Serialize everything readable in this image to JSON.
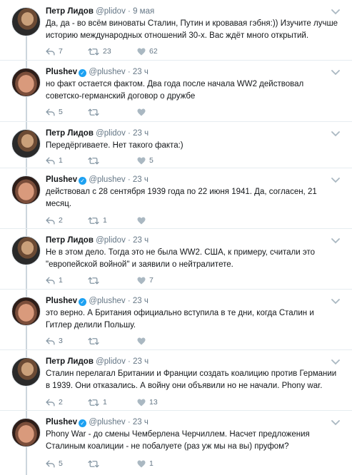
{
  "tweets": [
    {
      "author": "lidov",
      "name": "Петр Лидов",
      "handle": "@plidov",
      "time": "9 мая",
      "verified": false,
      "text": "Да, да - во всём виноваты Сталин, Путин и кровавая гэбня:)) Изучите лучше историю международных отношений 30-х. Вас ждёт много открытий.",
      "replies": "7",
      "retweets": "23",
      "likes": "62"
    },
    {
      "author": "plushev",
      "name": "Plushev",
      "handle": "@plushev",
      "time": "23 ч",
      "verified": true,
      "text": "но факт остается фактом. Два года после начала WW2 действовал советско-германский договор о дружбе",
      "replies": "5",
      "retweets": "",
      "likes": ""
    },
    {
      "author": "lidov",
      "name": "Петр Лидов",
      "handle": "@plidov",
      "time": "23 ч",
      "verified": false,
      "text": "Передёргиваете. Нет такого факта:)",
      "replies": "1",
      "retweets": "",
      "likes": "5"
    },
    {
      "author": "plushev",
      "name": "Plushev",
      "handle": "@plushev",
      "time": "23 ч",
      "verified": true,
      "text": "действовал с 28 сентября 1939 года по 22 июня 1941. Да, согласен, 21 месяц.",
      "replies": "2",
      "retweets": "1",
      "likes": ""
    },
    {
      "author": "lidov",
      "name": "Петр Лидов",
      "handle": "@plidov",
      "time": "23 ч",
      "verified": false,
      "text": "Не в этом дело. Тогда это не была WW2. США, к примеру, считали это \"европейской войной\" и заявили о нейтралитете.",
      "replies": "1",
      "retweets": "",
      "likes": "7"
    },
    {
      "author": "plushev",
      "name": "Plushev",
      "handle": "@plushev",
      "time": "23 ч",
      "verified": true,
      "text": "это верно. А Британия официально вступила в те дни, когда Сталин и Гитлер делили Польшу.",
      "replies": "3",
      "retweets": "",
      "likes": ""
    },
    {
      "author": "lidov",
      "name": "Петр Лидов",
      "handle": "@plidov",
      "time": "23 ч",
      "verified": false,
      "text": "Сталин перелагал Британии и Франции создать коалицию против Германии в 1939. Они отказались. А войну они объявили но не начали. Phony war.",
      "replies": "2",
      "retweets": "1",
      "likes": "13"
    },
    {
      "author": "plushev",
      "name": "Plushev",
      "handle": "@plushev",
      "time": "23 ч",
      "verified": true,
      "text": "Phony War - до смены Чемберлена Черчиллем. Насчет предложения Сталиным коалиции - не побалуете (раз уж мы на вы) пруфом?",
      "replies": "5",
      "retweets": "",
      "likes": "1"
    }
  ],
  "colors": {
    "text": "#14171a",
    "muted": "#657786",
    "verified": "#1da1f2",
    "thread_line": "#ccd6dd",
    "divider": "#e6ecf0"
  },
  "icons": [
    "reply-icon",
    "retweet-icon",
    "like-icon",
    "caret-down-icon",
    "verified-badge-icon"
  ]
}
